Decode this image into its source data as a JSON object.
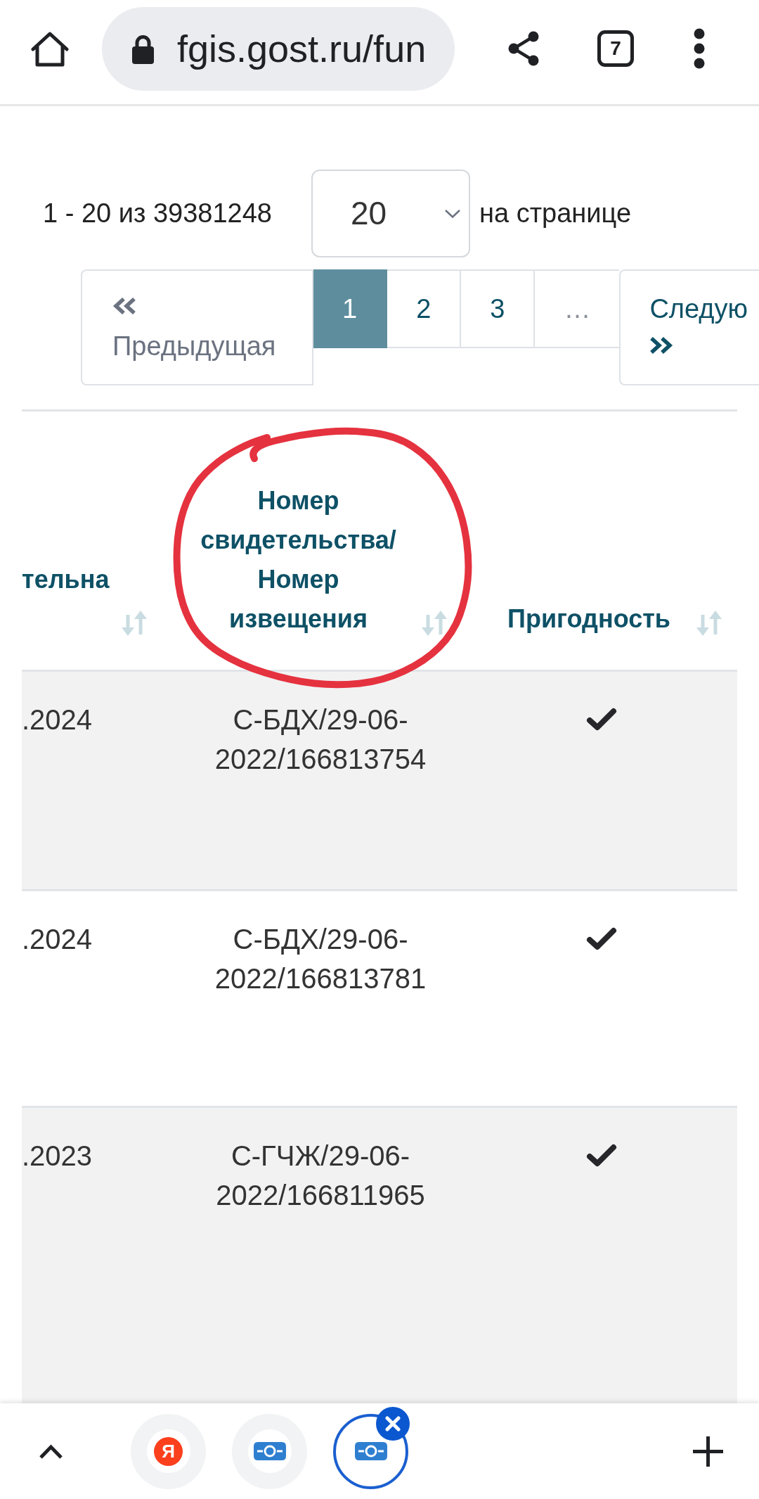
{
  "browser": {
    "url": "fgis.gost.ru/fun",
    "tab_count": "7"
  },
  "pagination": {
    "summary": "1 - 20 из 39381248",
    "page_size": "20",
    "page_size_suffix": "на странице",
    "previous": "Предыдущая",
    "pages": [
      {
        "label": "1",
        "selected": true
      },
      {
        "label": "2",
        "selected": false
      },
      {
        "label": "3",
        "selected": false
      }
    ],
    "gap": "…",
    "next": "Следую"
  },
  "table": {
    "columns": [
      {
        "label": "тельна"
      },
      {
        "label": "Номер свидетельства/Номер извещения"
      },
      {
        "label": "Пригодность"
      }
    ],
    "rows": [
      {
        "column_1": ".2024",
        "number": "С-БДХ/29-06-2022/166813754",
        "suitable": true
      },
      {
        "column_1": ".2024",
        "number": "С-БДХ/29-06-2022/166813781",
        "suitable": true
      },
      {
        "column_1": ".2023",
        "number": "С-ГЧЖ/29-06-2022/166811965",
        "suitable": true
      }
    ]
  },
  "annotations": [
    {
      "kind": "circle"
    }
  ],
  "tab_strip": [
    {
      "kind": "letter-logo",
      "logo": "Я",
      "selected": false
    },
    {
      "kind": "site-logo",
      "selected": false
    },
    {
      "kind": "site-logo",
      "selected": true
    }
  ]
}
